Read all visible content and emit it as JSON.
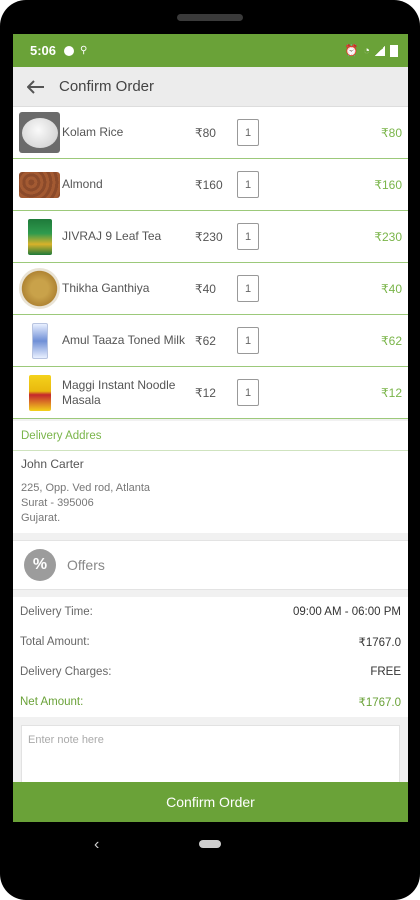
{
  "status": {
    "time": "5:06"
  },
  "header": {
    "title": "Confirm Order"
  },
  "products": [
    {
      "name": "Kolam Rice",
      "price": "₹80",
      "qty": "1",
      "total": "₹80"
    },
    {
      "name": "Almond",
      "price": "₹160",
      "qty": "1",
      "total": "₹160"
    },
    {
      "name": "JIVRAJ 9 Leaf Tea",
      "price": "₹230",
      "qty": "1",
      "total": "₹230"
    },
    {
      "name": "Thikha Ganthiya",
      "price": "₹40",
      "qty": "1",
      "total": "₹40"
    },
    {
      "name": "Amul Taaza Toned Milk",
      "price": "₹62",
      "qty": "1",
      "total": "₹62"
    },
    {
      "name": "Maggi Instant Noodle Masala",
      "price": "₹12",
      "qty": "1",
      "total": "₹12"
    }
  ],
  "delivery": {
    "heading": "Delivery Addres",
    "name": "John Carter",
    "line1": "225, Opp. Ved rod, Atlanta",
    "line2": "Surat - 395006",
    "line3": "Gujarat."
  },
  "offers": {
    "label": "Offers",
    "icon": "percent-badge-icon"
  },
  "summary": {
    "time_label": "Delivery Time:",
    "time_value": "09:00 AM - 06:00 PM",
    "total_label": "Total Amount:",
    "total_value": "₹1767.0",
    "charges_label": "Delivery Charges:",
    "charges_value": "FREE",
    "net_label": "Net Amount:",
    "net_value": "₹1767.0"
  },
  "note": {
    "placeholder": "Enter note here"
  },
  "confirm_label": "Confirm Order",
  "colors": {
    "primary": "#6aa238",
    "accent_text": "#7ab54a"
  }
}
